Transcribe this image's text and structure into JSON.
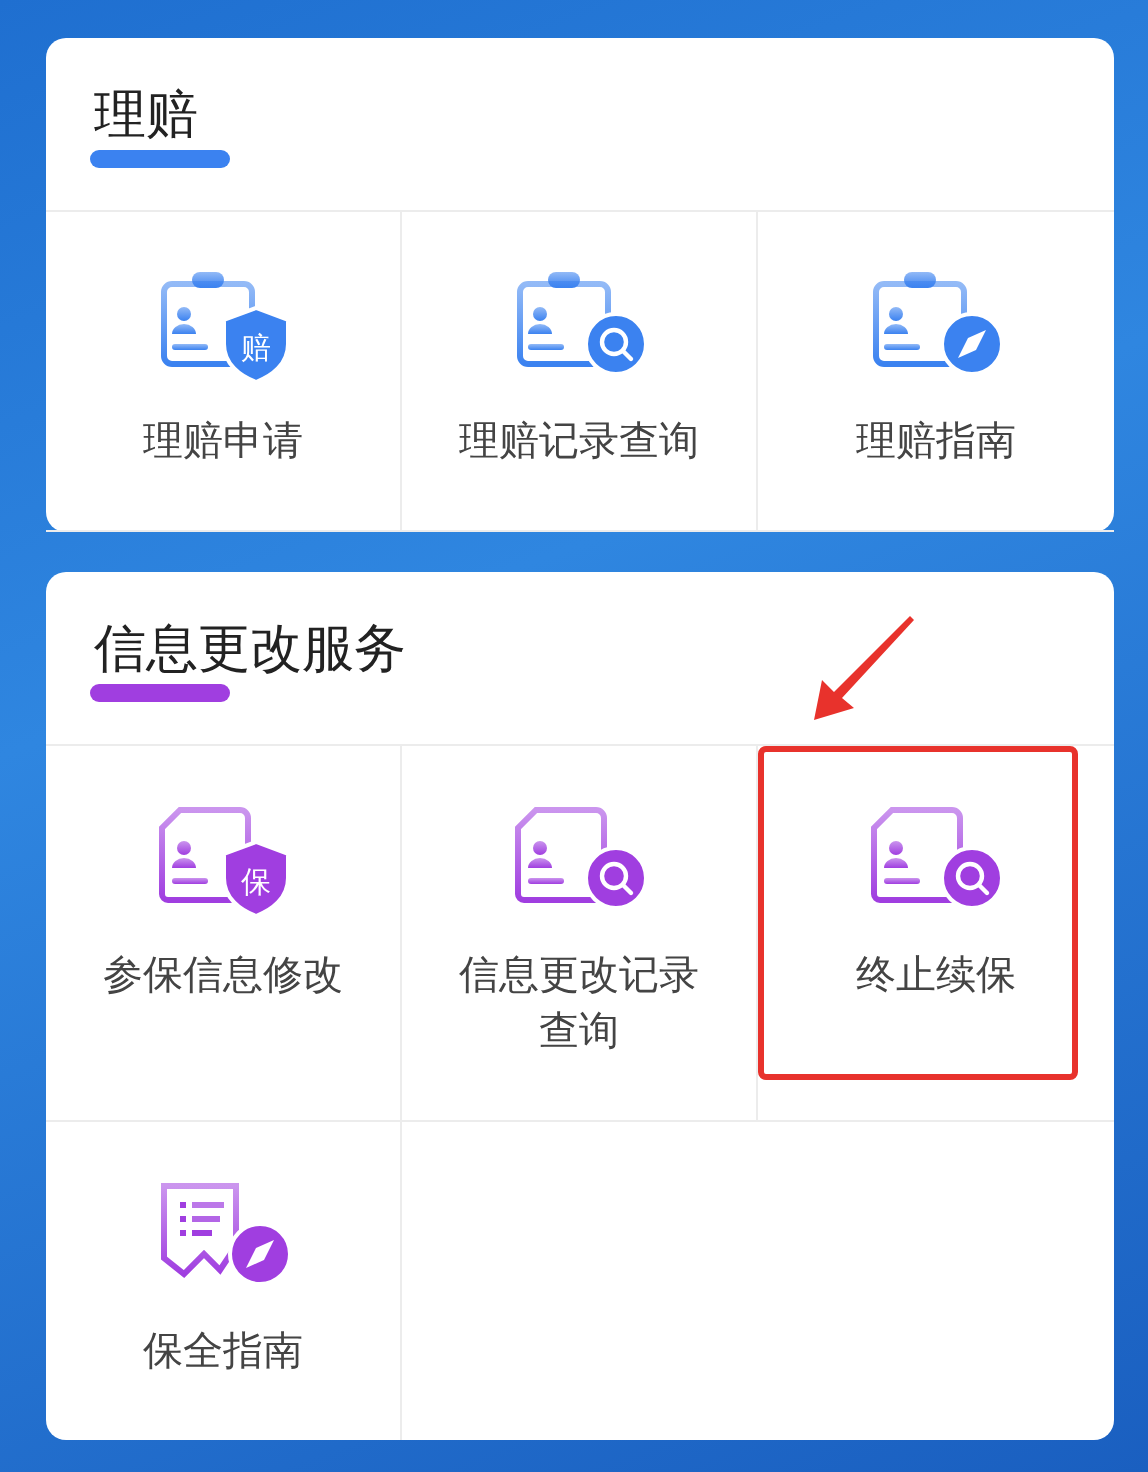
{
  "sections": [
    {
      "title": "理赔",
      "color": "#3b82f0",
      "items": [
        {
          "label": "理赔申请",
          "kind": "shield",
          "badge": "赔",
          "highlighted": false
        },
        {
          "label": "理赔记录查询",
          "kind": "search",
          "highlighted": false
        },
        {
          "label": "理赔指南",
          "kind": "compass",
          "highlighted": false
        }
      ]
    },
    {
      "title": "信息更改服务",
      "color": "#a03ee0",
      "items": [
        {
          "label": "参保信息修改",
          "kind": "shield",
          "badge": "保",
          "highlighted": false
        },
        {
          "label": "信息更改记录查询",
          "kind": "search",
          "highlighted": false
        },
        {
          "label": "终止续保",
          "kind": "search",
          "highlighted": true
        },
        {
          "label": "保全指南",
          "kind": "list-compass",
          "highlighted": false
        }
      ]
    }
  ]
}
